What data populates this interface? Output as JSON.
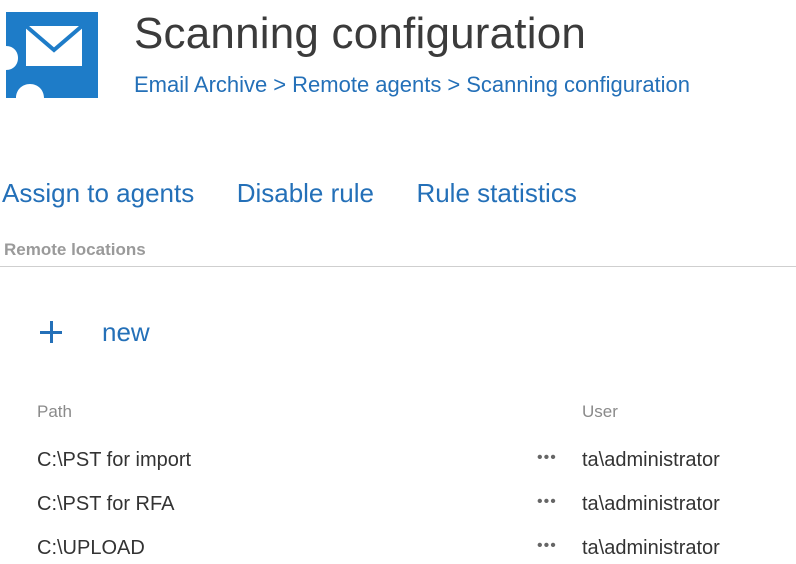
{
  "header": {
    "title": "Scanning configuration",
    "breadcrumb": [
      "Email Archive",
      "Remote agents",
      "Scanning configuration"
    ],
    "separator": ">",
    "logo_icon": "envelope-puzzle-icon",
    "brand_color": "#1e7cc8"
  },
  "actions": [
    "Assign to agents",
    "Disable rule",
    "Rule statistics"
  ],
  "section": {
    "label": "Remote locations"
  },
  "new_button": {
    "label": "new",
    "icon": "plus-icon"
  },
  "table": {
    "columns": [
      "Path",
      "User"
    ],
    "rows": [
      {
        "path": "C:\\PST for import",
        "menu": "•••",
        "user": "ta\\administrator"
      },
      {
        "path": "C:\\PST for RFA",
        "menu": "•••",
        "user": "ta\\administrator"
      },
      {
        "path": "C:\\UPLOAD",
        "menu": "•••",
        "user": "ta\\administrator"
      }
    ]
  }
}
